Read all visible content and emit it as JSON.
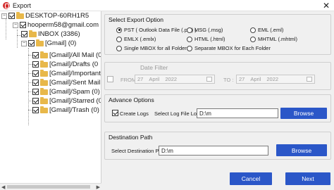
{
  "window": {
    "title": "Export",
    "close_glyph": "✕"
  },
  "tree": {
    "root": "DESKTOP-60RH1R5",
    "account": "hooperm58@gmail.com",
    "inbox": "INBOX (3386)",
    "gmail": "[Gmail] (0)",
    "folders": [
      "[Gmail]/All Mail (0",
      "[Gmail]/Drafts (0",
      "[Gmail]/Important",
      "[Gmail]/Sent Mail",
      "[Gmail]/Spam (0)",
      "[Gmail]/Starred (0",
      "[Gmail]/Trash (0)"
    ]
  },
  "export_option": {
    "title": "Select Export Option",
    "options": {
      "pst": "PST ( Outlook Data File (.pst) )",
      "msg": "MSG (.msg)",
      "eml": "EML (.eml)",
      "emlx": "EMLX (.emlx)",
      "html": "HTML (.html)",
      "mhtml": "MHTML (.mhtml)",
      "single_mbox": "Single MBOX for all Folders",
      "separate_mbox": "Separate MBOX for Each Folder"
    },
    "selected": "pst"
  },
  "date_filter": {
    "title": "Date Filter",
    "from_label": "FROM :",
    "to_label": "TO :",
    "from_day": "27",
    "from_month": "April",
    "from_year": "2022",
    "to_day": "27",
    "to_month": "April",
    "to_year": "2022"
  },
  "advance": {
    "title": "Advance Options",
    "create_logs": "Create Logs",
    "log_location_label": "Select Log File Location :",
    "log_location_value": "D:\\m",
    "browse": "Browse"
  },
  "destination": {
    "title": "Destination Path",
    "label": "Select Destination Path",
    "value": "D:\\m",
    "browse": "Browse"
  },
  "footer": {
    "cancel": "Cancel",
    "next": "Next"
  },
  "colors": {
    "button": "#2b57c8",
    "folder": "#e8b84a",
    "app_icon": "#d32f2f"
  }
}
